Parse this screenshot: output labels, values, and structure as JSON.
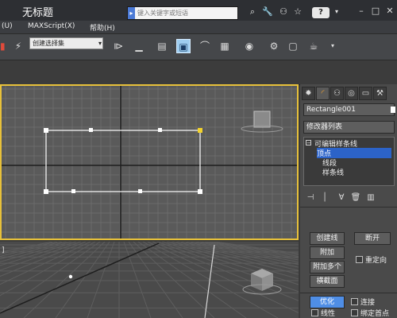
{
  "title_bar": {
    "title": "无标题",
    "search_placeholder": "键入关键字或短语",
    "help_label": "?"
  },
  "menu": {
    "items": [
      "(U)",
      "MAXScript(X)",
      "帮助(H)"
    ]
  },
  "toolbar": {
    "selection_set": "创建选择集",
    "active_tool_index": 3
  },
  "viewports": {
    "top_bracket": "",
    "persp_bracket": "]"
  },
  "command_panel": {
    "object_name": "Rectangle001",
    "modifier_list": "修改器列表",
    "stack": {
      "root": "可编辑样条线",
      "items": [
        "顶点",
        "线段",
        "样条线"
      ],
      "selected_index": 0
    },
    "buttons": {
      "create_line": "创建线",
      "break": "断开",
      "attach": "附加",
      "reorient": "重定向",
      "attach_multiple": "附加多个",
      "cross_section": "横截面",
      "optimize": "优化",
      "connect": "连接",
      "linear": "线性",
      "bind_first": "绑定首点"
    }
  },
  "colors": {
    "viewport_active_border": "#e8c13a",
    "selection_blue": "#2c63c8",
    "active_tool": "#9ecdf0"
  }
}
